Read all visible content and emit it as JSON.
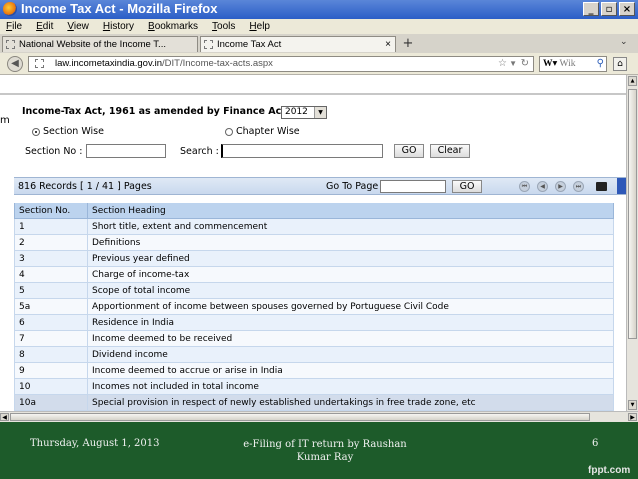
{
  "window": {
    "title": "Income Tax Act - Mozilla Firefox"
  },
  "menu": [
    "File",
    "Edit",
    "View",
    "History",
    "Bookmarks",
    "Tools",
    "Help"
  ],
  "tabs": [
    {
      "label": "National Website of the Income T...",
      "active": false
    },
    {
      "label": "Income Tax Act",
      "active": true
    }
  ],
  "address": {
    "host": "law.incometaxindia.gov.in",
    "path": "/DIT/Income-tax-acts.aspx"
  },
  "search_engine": "W",
  "search_placeholder": "Wik",
  "form": {
    "title": "Income-Tax Act, 1961 as amended by Finance Act",
    "year": "2012",
    "option_section_wise": "Section Wise",
    "option_chapter_wise": "Chapter Wise",
    "section_no_label": "Section No :",
    "search_label": "Search :",
    "go": "GO",
    "clear": "Clear"
  },
  "grid": {
    "records": "816 Records",
    "pages": "[ 1 / 41 ] Pages",
    "goto_label": "Go To Page",
    "go": "GO",
    "headers": {
      "no": "Section No.",
      "heading": "Section Heading"
    },
    "rows": [
      {
        "no": "1",
        "heading": "Short title, extent and commencement"
      },
      {
        "no": "2",
        "heading": "Definitions"
      },
      {
        "no": "3",
        "heading": "Previous year defined"
      },
      {
        "no": "4",
        "heading": "Charge of income-tax"
      },
      {
        "no": "5",
        "heading": "Scope of total income"
      },
      {
        "no": "5a",
        "heading": "Apportionment of income between spouses governed by Portuguese Civil Code"
      },
      {
        "no": "6",
        "heading": "Residence in India"
      },
      {
        "no": "7",
        "heading": "Income deemed to be received"
      },
      {
        "no": "8",
        "heading": "Dividend income"
      },
      {
        "no": "9",
        "heading": "Income deemed to accrue or arise in India"
      },
      {
        "no": "10",
        "heading": "Incomes not included in total income"
      },
      {
        "no": "10a",
        "heading": "Special provision in respect of newly established undertakings in free trade zone, etc"
      }
    ]
  },
  "footer": {
    "date": "Thursday, August 1, 2013",
    "center": "e-Filing of IT return by Raushan Kumar Ray",
    "page": "6",
    "brand": "fppt.com"
  },
  "colors": {
    "titlebar": "#2b5ec7",
    "grid_header": "#bcd3ee",
    "footer": "#1d5b2a"
  }
}
